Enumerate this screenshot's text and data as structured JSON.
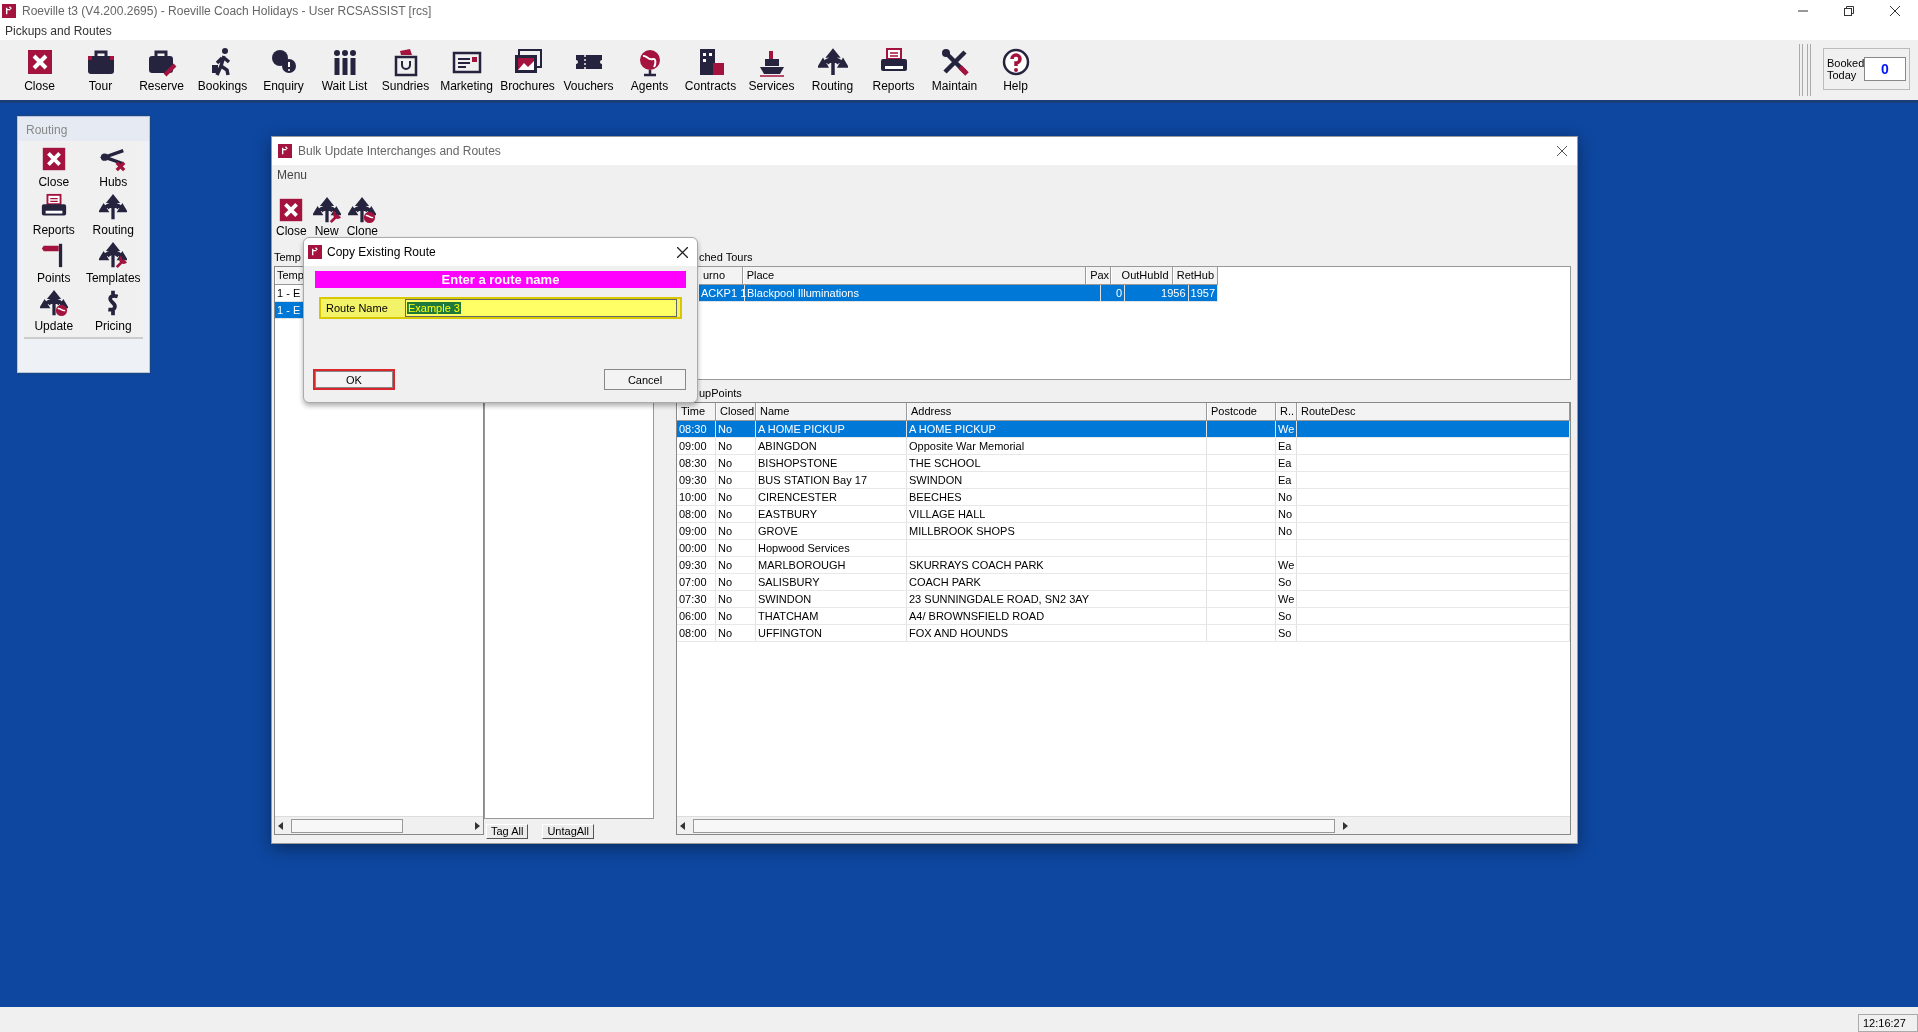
{
  "window": {
    "title": "Roeville t3 (V4.200.2695) - Roeville Coach Holidays - User RCSASSIST [rcs]",
    "menu": "Pickups and Routes"
  },
  "toolbar": [
    {
      "label": "Close"
    },
    {
      "label": "Tour"
    },
    {
      "label": "Reserve"
    },
    {
      "label": "Bookings"
    },
    {
      "label": "Enquiry"
    },
    {
      "label": "Wait List"
    },
    {
      "label": "Sundries"
    },
    {
      "label": "Marketing"
    },
    {
      "label": "Brochures"
    },
    {
      "label": "Vouchers"
    },
    {
      "label": "Agents"
    },
    {
      "label": "Contracts"
    },
    {
      "label": "Services"
    },
    {
      "label": "Routing"
    },
    {
      "label": "Reports"
    },
    {
      "label": "Maintain"
    },
    {
      "label": "Help"
    }
  ],
  "booked_today": {
    "label": "Booked Today",
    "value": "0"
  },
  "routing_panel": {
    "title": "Routing",
    "items": [
      {
        "label": "Close"
      },
      {
        "label": "Hubs"
      },
      {
        "label": "Reports"
      },
      {
        "label": "Routing"
      },
      {
        "label": "Points"
      },
      {
        "label": "Templates"
      },
      {
        "label": "Update"
      },
      {
        "label": "Pricing"
      }
    ]
  },
  "bulk_window": {
    "title": "Bulk Update Interchanges and Routes",
    "menu": "Menu",
    "toolbar": [
      {
        "label": "Close"
      },
      {
        "label": "New"
      },
      {
        "label": "Clone"
      }
    ],
    "templates": {
      "label": "Temp",
      "columns": [
        "Temp"
      ],
      "rows": [
        {
          "text": "1 - E",
          "selected": false
        },
        {
          "text": "1 - E",
          "selected": true
        }
      ]
    },
    "tag_buttons": [
      "Tag All",
      "UntagAll"
    ],
    "tours": {
      "label": "ched Tours",
      "columns": [
        "urno",
        "Place",
        "Pax",
        "OutHubId",
        "RetHub"
      ],
      "rows": [
        {
          "urno": "ACKP1 1",
          "place": "Blackpool Illuminations",
          "pax": "0",
          "out_hub": "1956",
          "ret_hub": "1957",
          "selected": true
        }
      ]
    },
    "pickup_points": {
      "label": "upPoints",
      "columns": [
        "Time",
        "Closed",
        "Name",
        "Address",
        "Postcode",
        "R..",
        "RouteDesc"
      ],
      "rows": [
        {
          "time": "08:30",
          "closed": "No",
          "name": "A HOME PICKUP",
          "address": "A HOME PICKUP",
          "r": "We",
          "selected": true
        },
        {
          "time": "09:00",
          "closed": "No",
          "name": "ABINGDON",
          "address": "Opposite War Memorial",
          "r": "Ea",
          "selected": false
        },
        {
          "time": "08:30",
          "closed": "No",
          "name": "BISHOPSTONE",
          "address": "THE SCHOOL",
          "r": "Ea",
          "selected": false
        },
        {
          "time": "09:30",
          "closed": "No",
          "name": "BUS STATION Bay 17",
          "address": "SWINDON",
          "r": "Ea",
          "selected": false
        },
        {
          "time": "10:00",
          "closed": "No",
          "name": "CIRENCESTER",
          "address": "BEECHES",
          "r": "No",
          "selected": false
        },
        {
          "time": "08:00",
          "closed": "No",
          "name": "EASTBURY",
          "address": "VILLAGE HALL",
          "r": "No",
          "selected": false
        },
        {
          "time": "09:00",
          "closed": "No",
          "name": "GROVE",
          "address": "MILLBROOK SHOPS",
          "r": "No",
          "selected": false
        },
        {
          "time": "00:00",
          "closed": "No",
          "name": "Hopwood Services",
          "selected": false
        },
        {
          "time": "09:30",
          "closed": "No",
          "name": "MARLBOROUGH",
          "address": "SKURRAYS COACH PARK",
          "r": "We",
          "selected": false
        },
        {
          "time": "07:00",
          "closed": "No",
          "name": "SALISBURY",
          "address": "COACH PARK",
          "r": "So",
          "selected": false
        },
        {
          "time": "07:30",
          "closed": "No",
          "name": "SWINDON",
          "address": "23 SUNNINGDALE ROAD, SN2 3AY",
          "r": "We",
          "selected": false
        },
        {
          "time": "06:00",
          "closed": "No",
          "name": "THATCHAM",
          "address": "A4/ BROWNSFIELD ROAD",
          "r": "So",
          "selected": false
        },
        {
          "time": "08:00",
          "closed": "No",
          "name": "UFFINGTON",
          "address": "FOX AND HOUNDS",
          "r": "So",
          "selected": false
        }
      ]
    }
  },
  "dialog": {
    "title": "Copy Existing Route",
    "banner": "Enter a route name",
    "field_label": "Route Name",
    "value": "Example 3",
    "buttons": [
      {
        "label": "OK",
        "focused": true
      },
      {
        "label": "Cancel",
        "focused": false
      }
    ]
  },
  "status_bar": {
    "clock": "12:16:27"
  }
}
